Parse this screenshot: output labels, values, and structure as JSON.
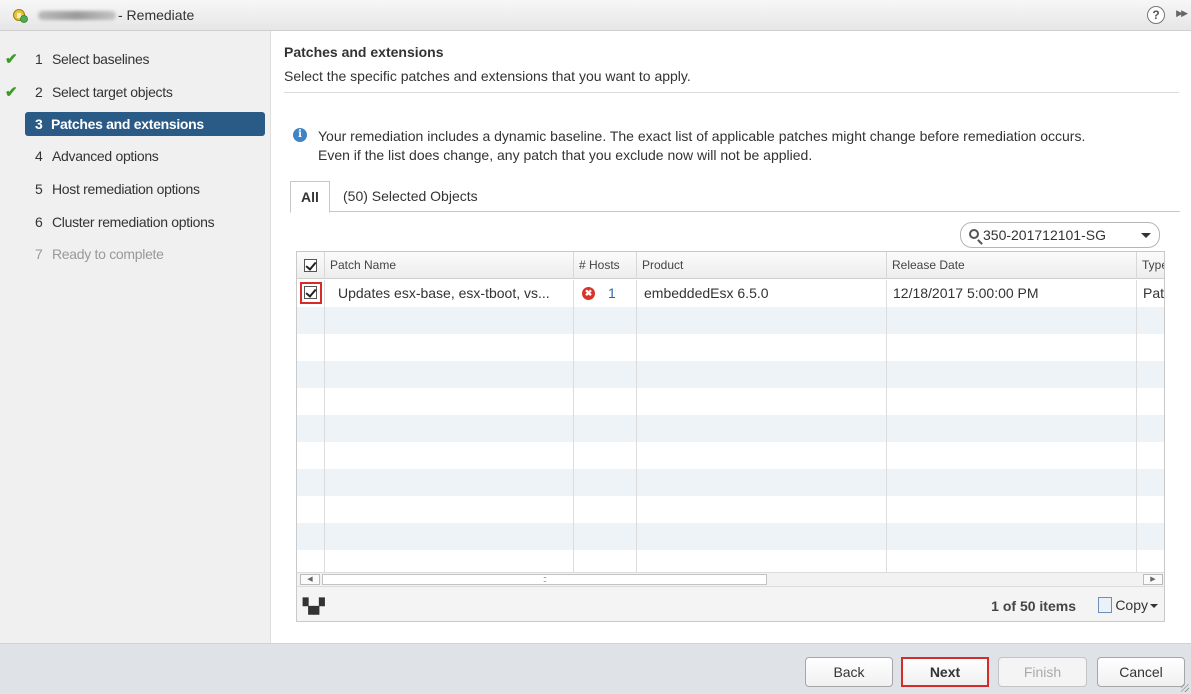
{
  "window": {
    "title": "- Remediate",
    "help_label": "?",
    "expand_label": "▶▶"
  },
  "steps": [
    {
      "num": "1",
      "label": "Select baselines",
      "state": "done",
      "check": "✔"
    },
    {
      "num": "2",
      "label": "Select target objects",
      "state": "done",
      "check": "✔"
    },
    {
      "num": "3",
      "label": "Patches and extensions",
      "state": "active"
    },
    {
      "num": "4",
      "label": "Advanced options",
      "state": "pending"
    },
    {
      "num": "5",
      "label": "Host remediation options",
      "state": "pending"
    },
    {
      "num": "6",
      "label": "Cluster remediation options",
      "state": "pending"
    },
    {
      "num": "7",
      "label": "Ready to complete",
      "state": "disabled"
    }
  ],
  "main": {
    "heading": "Patches and extensions",
    "subheading": "Select the specific patches and extensions that you want to apply.",
    "info_icon": "i",
    "info_line1": "Your remediation includes a dynamic baseline. The exact list of applicable patches might change before remediation occurs.",
    "info_line2": "Even if the list does change, any patch that you exclude now will not be applied.",
    "tabs": [
      {
        "label": "All",
        "active": true
      },
      {
        "label": "(50) Selected Objects",
        "active": false
      }
    ],
    "filter": {
      "value": "350-201712101-SG"
    }
  },
  "grid": {
    "columns": [
      "Patch Name",
      "# Hosts",
      "Product",
      "Release Date",
      "Type"
    ],
    "rows": [
      {
        "checked": true,
        "patch_name": "Updates esx-base, esx-tboot, vs...",
        "hosts_icon": "✖",
        "hosts": "1",
        "product": "embeddedEsx 6.5.0",
        "release_date": "12/18/2017 5:00:00 PM",
        "type": "Patch"
      }
    ],
    "scroll": {
      "left_arrow": "◀",
      "right_arrow": "▶",
      "grip": "::"
    },
    "footer": {
      "count": "1 of 50 items",
      "copy_label": "Copy",
      "binoculars": "▚▞"
    }
  },
  "buttons": {
    "back": "Back",
    "next": "Next",
    "finish": "Finish",
    "cancel": "Cancel"
  },
  "colors": {
    "accent": "#2a5a86",
    "check": "#3a9d23",
    "highlight": "#d52b2b",
    "info": "#3f84c6",
    "error": "#d8342c"
  }
}
